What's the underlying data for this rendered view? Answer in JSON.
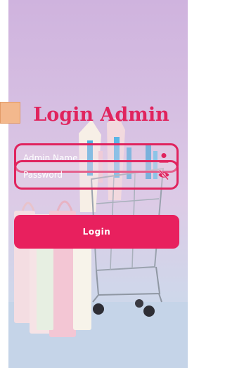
{
  "header": {
    "title": "Login Admin"
  },
  "form": {
    "username": {
      "placeholder": "Admin Name",
      "value": "",
      "icon": "person-icon"
    },
    "password": {
      "placeholder": "Password",
      "value": "",
      "icon": "eye-off-icon"
    },
    "login_label": "Login"
  },
  "theme": {
    "accent": "#e0245e",
    "tab_color": "#f3b88d",
    "background": "#d6bfe2"
  }
}
